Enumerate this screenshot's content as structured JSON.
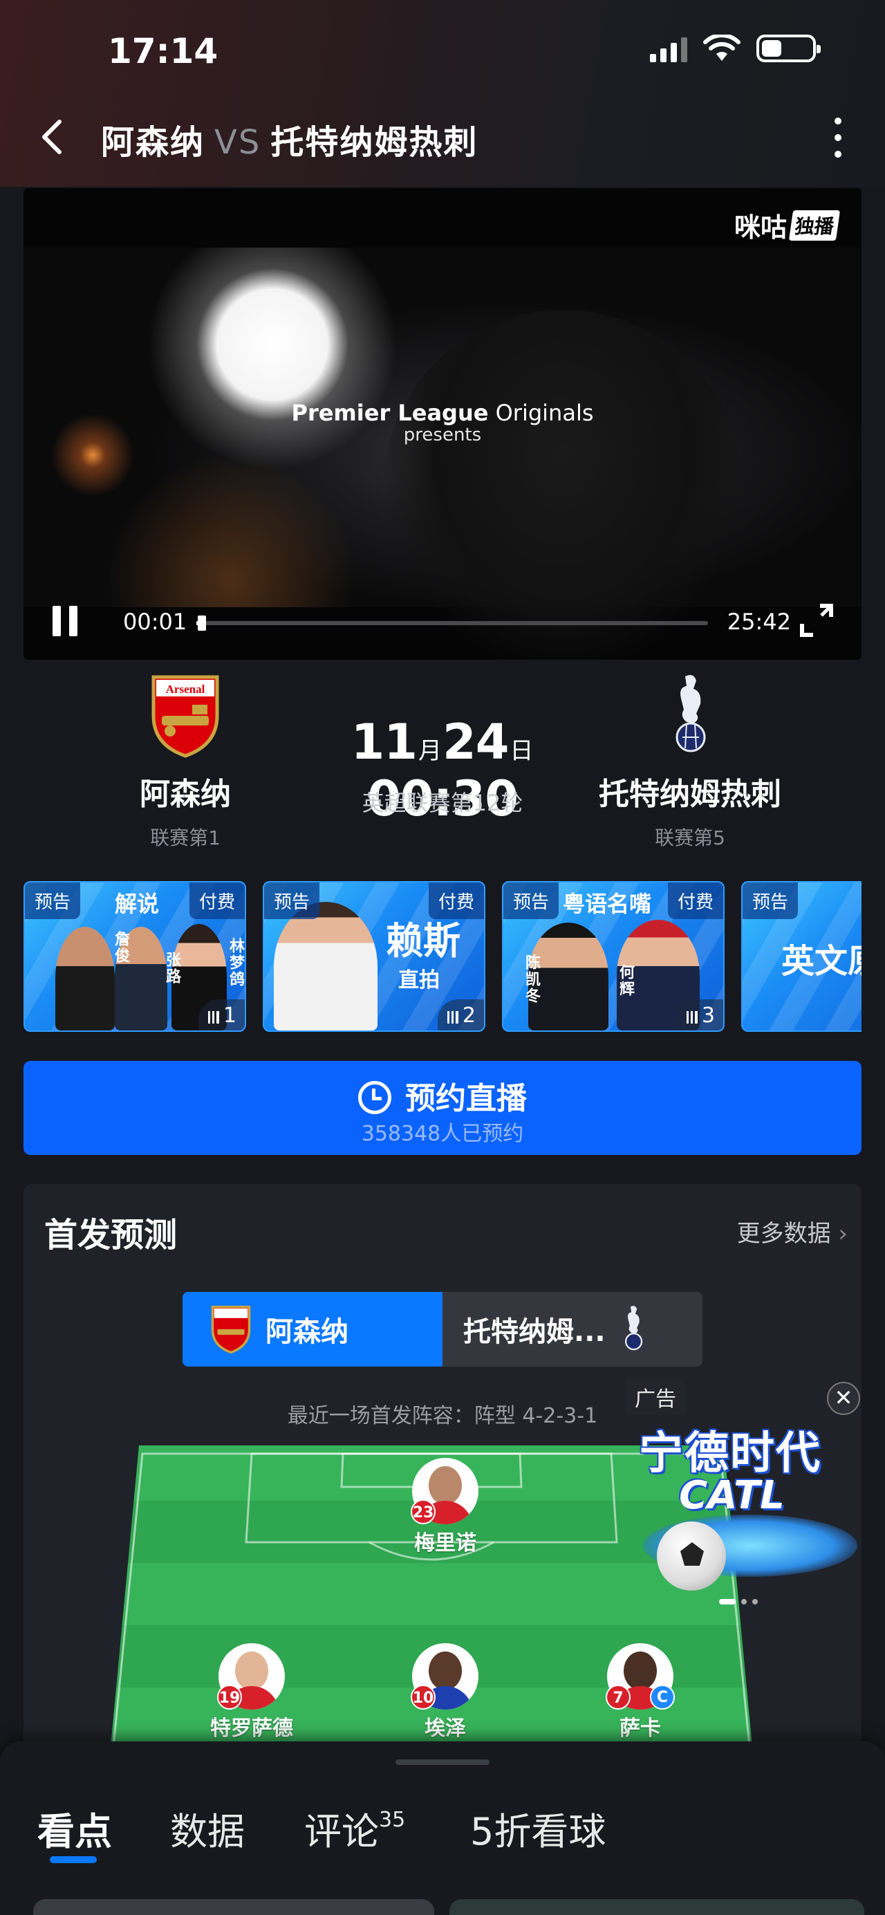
{
  "status": {
    "time": "17:14"
  },
  "header": {
    "home": "阿森纳",
    "vs": "VS",
    "away": "托特纳姆热刺"
  },
  "video": {
    "logo": "咪咕",
    "logo_tag": "独播",
    "overlay_brand": "Premier League",
    "overlay_brand2": "Originals",
    "overlay_sub": "presents",
    "current_time": "00:01",
    "duration": "25:42",
    "progress_fraction": 0.0006
  },
  "match": {
    "home": {
      "name": "阿森纳",
      "rank": "联赛第1",
      "badge_text": "Arsenal"
    },
    "away": {
      "name": "托特纳姆热刺",
      "rank": "联赛第5"
    },
    "month": "11",
    "month_unit": "月",
    "day": "24",
    "day_unit": "日",
    "time": "00:30",
    "competition": "英超联赛第12轮"
  },
  "cards": [
    {
      "tag": "预告",
      "title": "解说",
      "paid": "付费",
      "names": [
        "詹俊",
        "张路",
        "林梦鸽"
      ],
      "num": "1"
    },
    {
      "tag": "预告",
      "big": "赖斯",
      "sub": "直拍",
      "paid": "付费",
      "num": "2"
    },
    {
      "tag": "预告",
      "title": "粤语名嘴",
      "paid": "付费",
      "names": [
        "陈凯冬",
        "何辉"
      ],
      "num": "3"
    },
    {
      "tag": "预告",
      "big": "英文原"
    }
  ],
  "reserve": {
    "label": "预约直播",
    "count": "358348人已预约"
  },
  "lineup": {
    "title": "首发预测",
    "more": "更多数据",
    "toggle_home": "阿森纳",
    "toggle_away": "托特纳姆...",
    "recent": "最近一场首发阵容：阵型 4-2-3-1",
    "players": [
      {
        "num": "23",
        "name": "梅里诺"
      },
      {
        "num": "19",
        "name": "特罗萨德"
      },
      {
        "num": "10",
        "name": "埃泽"
      },
      {
        "num": "7",
        "name": "萨卡",
        "captain": "C"
      }
    ]
  },
  "ad": {
    "label": "广告",
    "close": "✕",
    "brand": "宁德时代",
    "brand_en": "CATL"
  },
  "tabs": [
    {
      "label": "看点"
    },
    {
      "label": "数据"
    },
    {
      "label": "评论",
      "count": "35"
    },
    {
      "label": "5折看球"
    }
  ],
  "colors": {
    "accent": "#0a78ff",
    "reserve": "#0a63ff",
    "arsenal_red": "#d8202a",
    "pitch": "#37b35a"
  }
}
